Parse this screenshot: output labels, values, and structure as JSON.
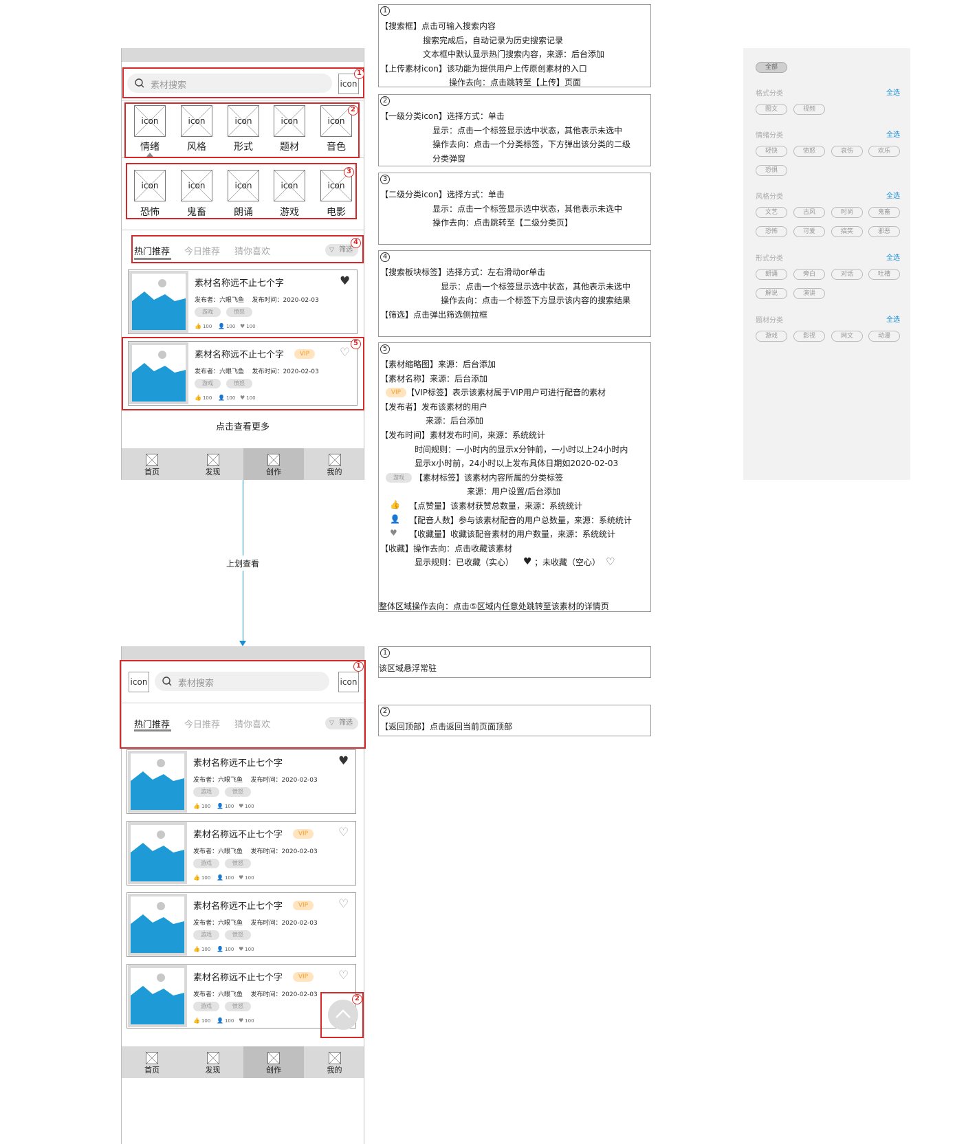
{
  "search": {
    "placeholder": "素材搜索"
  },
  "icon_text": "icon",
  "categories_level1": [
    "情绪",
    "风格",
    "形式",
    "题材",
    "音色"
  ],
  "categories_level2": [
    "恐怖",
    "鬼畜",
    "朗诵",
    "游戏",
    "电影"
  ],
  "tabs": [
    "热门推荐",
    "今日推荐",
    "猜你喜欢"
  ],
  "filter_label": "筛选",
  "card": {
    "title": "素材名称远不止七个字",
    "meta": "发布者：六眼飞鱼    发布时间：2020-02-03",
    "tags": [
      "游戏",
      "愤怒"
    ],
    "vip": "VIP",
    "stats": [
      "100",
      "100",
      "100"
    ]
  },
  "more_label": "点击查看更多",
  "nav": [
    "首页",
    "发现",
    "创作",
    "我的"
  ],
  "nav_active": "创作",
  "swipe_label": "上划查看",
  "badges": [
    "1",
    "2",
    "3",
    "4",
    "5"
  ],
  "notes": [
    {
      "num": "1",
      "lines": [
        "【搜索框】点击可输入搜索内容",
        "搜索完成后，自动记录为历史搜索记录",
        "文本框中默认显示热门搜索内容，来源：后台添加",
        "【上传素材icon】该功能为提供用户上传原创素材的入口",
        "操作去向：点击跳转至【上传】页面"
      ]
    },
    {
      "num": "2",
      "lines": [
        "【一级分类icon】选择方式：单击",
        "显示：点击一个标签显示选中状态，其他表示未选中",
        "操作去向：点击一个分类标签，下方弹出该分类的二级",
        "分类弹窗"
      ]
    },
    {
      "num": "3",
      "lines": [
        "【二级分类icon】选择方式：单击",
        "显示：点击一个标签显示选中状态，其他表示未选中",
        "操作去向：点击跳转至【二级分类页】"
      ]
    },
    {
      "num": "4",
      "lines": [
        "【搜索板块标签】选择方式：左右滑动or单击",
        "显示：点击一个标签显示选中状态，其他表示未选中",
        "操作去向：点击一个标签下方显示该内容的搜索结果",
        "【筛选】点击弹出筛选侧拉框"
      ]
    },
    {
      "num": "5",
      "lines": [
        "【素材缩略图】来源：后台添加",
        "【素材名称】来源：后台添加",
        "【VIP标签】表示该素材属于VIP用户可进行配音的素材",
        "【发布者】发布该素材的用户",
        "来源：后台添加",
        "【发布时间】素材发布时间，来源：系统统计",
        "时间规则：一小时内的显示x分钟前，一小时以上24小时内",
        "显示x小时前，24小时以上发布具体日期如2020-02-03",
        "【素材标签】该素材内容所属的分类标签",
        "来源：用户设置/后台添加",
        "【点赞量】该素材获赞总数量，来源：系统统计",
        "【配音人数】参与该素材配音的用户总数量，来源：系统统计",
        "【收藏量】收藏该配音素材的用户数量，来源：系统统计",
        "【收藏】操作去向：点击收藏该素材",
        "显示规则：已收藏（实心）",
        "；未收藏（空心）",
        "整体区域操作去向：点击⑤区域内任意处跳转至该素材的详情页"
      ]
    },
    {
      "num": "1",
      "lines": [
        "该区域悬浮常驻"
      ]
    },
    {
      "num": "2",
      "lines": [
        "【返回顶部】点击返回当前页面顶部"
      ]
    }
  ],
  "side_panel": {
    "all_label": "全部",
    "select_all": "全选",
    "sections": [
      {
        "title": "格式分类",
        "items": [
          "图文",
          "视频"
        ]
      },
      {
        "title": "情绪分类",
        "items": [
          "轻快",
          "愤怒",
          "哀伤",
          "欢乐",
          "恐惧"
        ]
      },
      {
        "title": "风格分类",
        "items": [
          "文艺",
          "古风",
          "时尚",
          "鬼畜",
          "恐怖",
          "可爱",
          "搞笑",
          "邪恶"
        ]
      },
      {
        "title": "形式分类",
        "items": [
          "朗诵",
          "旁白",
          "对话",
          "吐槽",
          "解说",
          "演讲"
        ]
      },
      {
        "title": "题材分类",
        "items": [
          "游戏",
          "影视",
          "网文",
          "动漫"
        ]
      }
    ]
  },
  "colors": {
    "accent_red": "#d62828",
    "thumb_blue": "#1e9ad6",
    "link_blue": "#1a8fd6"
  }
}
